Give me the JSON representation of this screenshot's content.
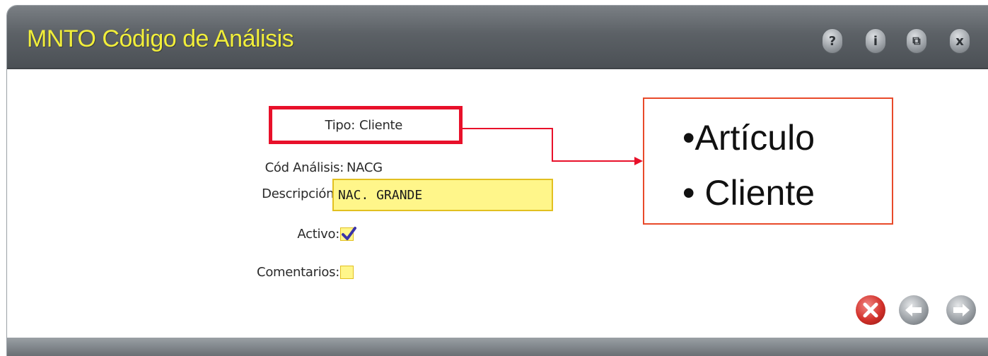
{
  "window": {
    "title": "MNTO Código de Análisis",
    "buttons": [
      {
        "name": "help",
        "glyph": "?"
      },
      {
        "name": "info",
        "glyph": "i"
      },
      {
        "name": "restore",
        "glyph": "⧉"
      },
      {
        "name": "close",
        "glyph": "x"
      }
    ]
  },
  "form": {
    "tipo_label": "Tipo:",
    "tipo_value": "Cliente",
    "cod_label": "Cód Análisis:",
    "cod_value": "NACG",
    "desc_label": "Descripción:",
    "desc_value": "NAC. GRANDE",
    "activo_label": "Activo:",
    "activo_checked": true,
    "comentarios_label": "Comentarios:",
    "comentarios_checked": false
  },
  "callout": {
    "items": [
      "•Artículo",
      "• Cliente"
    ]
  },
  "actions": {
    "cancel_icon": "cancel-icon",
    "back_icon": "arrow-left-icon",
    "forward_icon": "arrow-right-icon"
  },
  "colors": {
    "title_text": "#f1ee3a",
    "field_bg": "#fff68a",
    "highlight_red": "#e8102a"
  }
}
